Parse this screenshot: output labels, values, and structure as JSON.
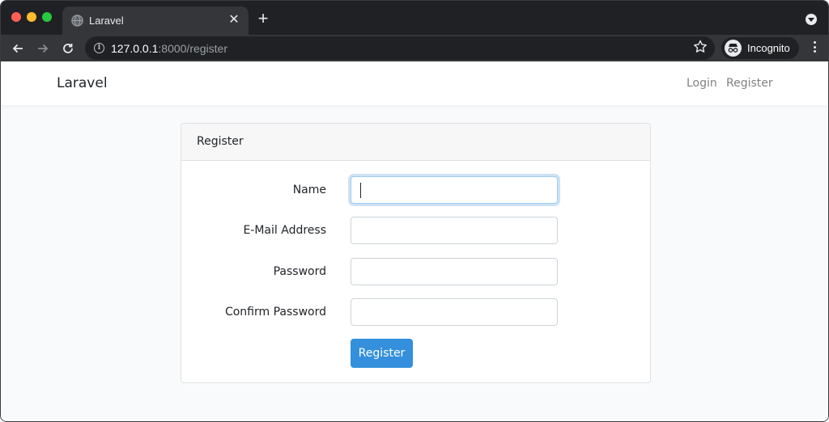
{
  "browser": {
    "tab_title": "Laravel",
    "tab_close_glyph": "✕",
    "new_tab_glyph": "+",
    "url_host": "127.0.0.1",
    "url_rest": ":8000/register",
    "incognito_label": "Incognito",
    "icons": {
      "favicon": "globe-icon",
      "back": "back-arrow-icon",
      "forward": "forward-arrow-icon",
      "reload": "reload-icon",
      "info": "info-icon",
      "star": "star-icon",
      "incognito": "incognito-icon",
      "menu": "kebab-menu-icon",
      "tab_search": "chevron-down-icon"
    }
  },
  "navbar": {
    "brand": "Laravel",
    "links": [
      "Login",
      "Register"
    ]
  },
  "card": {
    "title": "Register",
    "fields": [
      {
        "label": "Name",
        "value": "",
        "focused": true
      },
      {
        "label": "E-Mail Address",
        "value": "",
        "focused": false
      },
      {
        "label": "Password",
        "value": "",
        "focused": false
      },
      {
        "label": "Confirm Password",
        "value": "",
        "focused": false
      }
    ],
    "submit_label": "Register"
  },
  "colors": {
    "primary": "#3490dc",
    "page_background": "#f8fafc",
    "browser_frame": "#202124",
    "traffic_red": "#fe5f57",
    "traffic_yellow": "#febc2e",
    "traffic_green": "#28c840"
  }
}
